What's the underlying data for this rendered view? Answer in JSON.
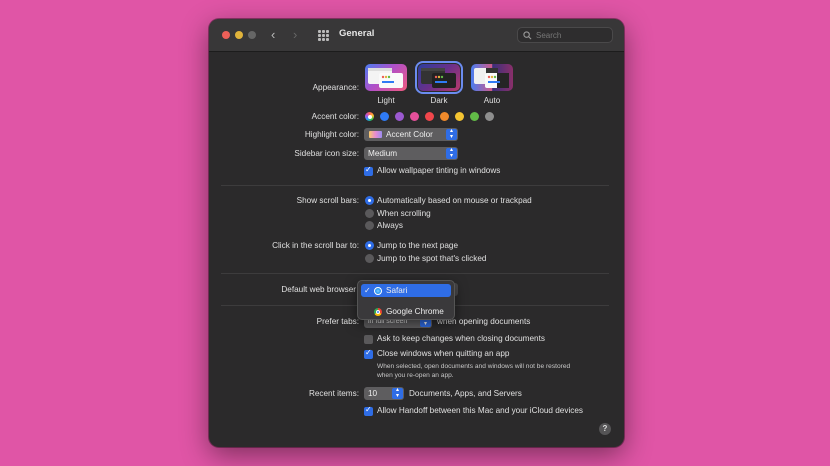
{
  "window": {
    "title": "General"
  },
  "search": {
    "placeholder": "Search"
  },
  "appearance": {
    "label": "Appearance:",
    "options": [
      "Light",
      "Dark",
      "Auto"
    ],
    "selected": "Dark"
  },
  "accent": {
    "label": "Accent color:",
    "colors": [
      "multicolor",
      "#2f7bf5",
      "#9b59d0",
      "#e5509b",
      "#f0464b",
      "#f08a2b",
      "#f4c431",
      "#62bb47",
      "#8e8e8e"
    ]
  },
  "highlight": {
    "label": "Highlight color:",
    "value": "Accent Color"
  },
  "sidebar_size": {
    "label": "Sidebar icon size:",
    "value": "Medium"
  },
  "wallpaper_tinting": {
    "label": "Allow wallpaper tinting in windows",
    "checked": true
  },
  "scroll_bars": {
    "label": "Show scroll bars:",
    "options": [
      "Automatically based on mouse or trackpad",
      "When scrolling",
      "Always"
    ]
  },
  "scroll_click": {
    "label": "Click in the scroll bar to:",
    "options": [
      "Jump to the next page",
      "Jump to the spot that's clicked"
    ]
  },
  "browser": {
    "label": "Default web browser",
    "options": [
      "Safari",
      "Google Chrome"
    ]
  },
  "prefer_tabs": {
    "label": "Prefer tabs:",
    "value": "in full screen",
    "suffix": "when opening documents"
  },
  "ask_keep_changes": {
    "label": "Ask to keep changes when closing documents",
    "checked": false
  },
  "close_windows": {
    "label": "Close windows when quitting an app",
    "checked": true,
    "note_line1": "When selected, open documents and windows will not be restored",
    "note_line2": "when you re-open an app."
  },
  "recent_items": {
    "label": "Recent items:",
    "value": "10",
    "suffix": "Documents, Apps, and Servers"
  },
  "handoff": {
    "label": "Allow Handoff between this Mac and your iCloud devices",
    "checked": true
  },
  "help": {
    "label": "?"
  }
}
